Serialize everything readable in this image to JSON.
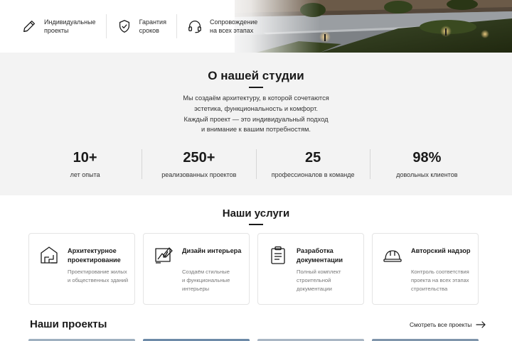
{
  "features": [
    {
      "icon": "pencil-icon",
      "label": "Индивидуальные\nпроекты"
    },
    {
      "icon": "shield-check-icon",
      "label": "Гарантия\nсроков"
    },
    {
      "icon": "headset-icon",
      "label": "Сопровождение\nна всех этапах"
    }
  ],
  "about": {
    "title": "О нашей студии",
    "text_lines": [
      "Мы создаём архитектуру, в которой сочетаются",
      "эстетика, функциональность и комфорт.",
      "Каждый проект — это индивидуальный подход",
      "и внимание к вашим потребностям."
    ],
    "stats": [
      {
        "value": "10+",
        "label": "лет опыта"
      },
      {
        "value": "250+",
        "label": "реализованных проектов"
      },
      {
        "value": "25",
        "label": "профессионалов в команде"
      },
      {
        "value": "98%",
        "label": "довольных клиентов"
      }
    ]
  },
  "services": {
    "title": "Наши услуги",
    "cards": [
      {
        "icon": "house-plan-icon",
        "title": "Архитектурное\nпроектирование",
        "desc": "Проектирование жилых\nи общественных зданий"
      },
      {
        "icon": "interior-drawing-icon",
        "title": "Дизайн интерьера",
        "desc": "Создаём стильные\nи функциональные\nинтерьеры"
      },
      {
        "icon": "clipboard-icon",
        "title": "Разработка\nдокументации",
        "desc": "Полный комплект\nстроительной\nдокументации"
      },
      {
        "icon": "hard-hat-icon",
        "title": "Авторский надзор",
        "desc": "Контроль соответствия\nпроекта на всех этапах\nстроительства"
      }
    ]
  },
  "projects": {
    "title": "Наши проекты",
    "view_all": "Смотреть все проекты"
  },
  "colors": {
    "text": "#1a1a1a",
    "muted": "#777777",
    "section_bg": "#f3f3f3",
    "border": "#e4e4e4"
  }
}
